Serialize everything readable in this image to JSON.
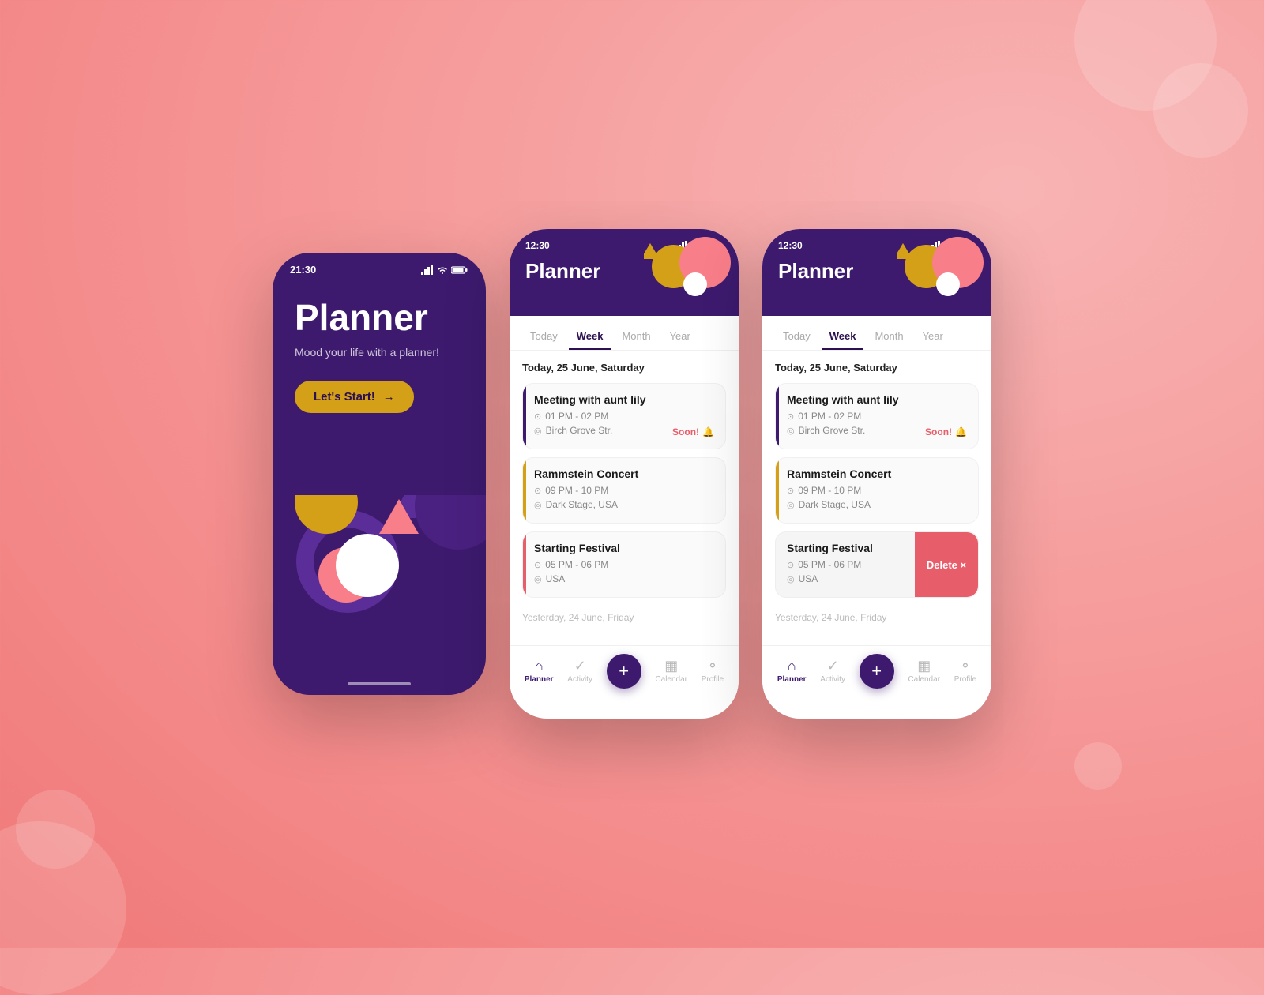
{
  "background": {
    "color": "#f9a0a0"
  },
  "phone1": {
    "status": {
      "time": "21:30"
    },
    "title": "Planner",
    "subtitle": "Mood your life with a planner!",
    "start_button": "Let's Start!",
    "arrow": "→"
  },
  "phone2": {
    "status": {
      "time": "12:30"
    },
    "title": "Planner",
    "tabs": [
      "Today",
      "Week",
      "Month",
      "Year"
    ],
    "active_tab": "Week",
    "date_header": "Today, 25 June, Saturday",
    "events": [
      {
        "name": "Meeting with aunt lily",
        "time": "01 PM - 02 PM",
        "location": "Birch Grove Str.",
        "soon": true,
        "color": "purple"
      },
      {
        "name": "Rammstein Concert",
        "time": "09 PM - 10 PM",
        "location": "Dark Stage, USA",
        "soon": false,
        "color": "yellow"
      },
      {
        "name": "Starting Festival",
        "time": "05 PM - 06 PM",
        "location": "USA",
        "soon": false,
        "color": "red"
      }
    ],
    "yesterday_label": "Yesterday, 24 June, Friday",
    "nav": {
      "items": [
        "Planner",
        "Activity",
        "",
        "Calendar",
        "Profile"
      ],
      "active": "Planner",
      "plus_label": "+"
    }
  },
  "phone3": {
    "status": {
      "time": "12:30"
    },
    "title": "Planner",
    "tabs": [
      "Today",
      "Week",
      "Month",
      "Year"
    ],
    "active_tab": "Week",
    "date_header": "Today, 25 June, Saturday",
    "events": [
      {
        "name": "Meeting with aunt lily",
        "time": "01 PM - 02 PM",
        "location": "Birch Grove Str.",
        "soon": true,
        "color": "purple"
      },
      {
        "name": "Rammstein Concert",
        "time": "09 PM - 10 PM",
        "location": "Dark Stage, USA",
        "soon": false,
        "color": "yellow"
      },
      {
        "name": "Starting Festival",
        "time": "05 PM - 06 PM",
        "location": "USA",
        "soon": false,
        "color": "red-full"
      }
    ],
    "delete_label": "Delete ×",
    "yesterday_label": "Yesterday, 24 June, Friday",
    "nav": {
      "items": [
        "Planner",
        "Activity",
        "",
        "Calendar",
        "Profile"
      ],
      "active": "Planner",
      "plus_label": "+"
    }
  },
  "labels": {
    "soon": "Soon!",
    "bell": "🔔",
    "clock": "⏱",
    "pin": "📍",
    "home": "⌂",
    "check": "✓",
    "calendar_icon": "▦",
    "user": "⚬"
  }
}
